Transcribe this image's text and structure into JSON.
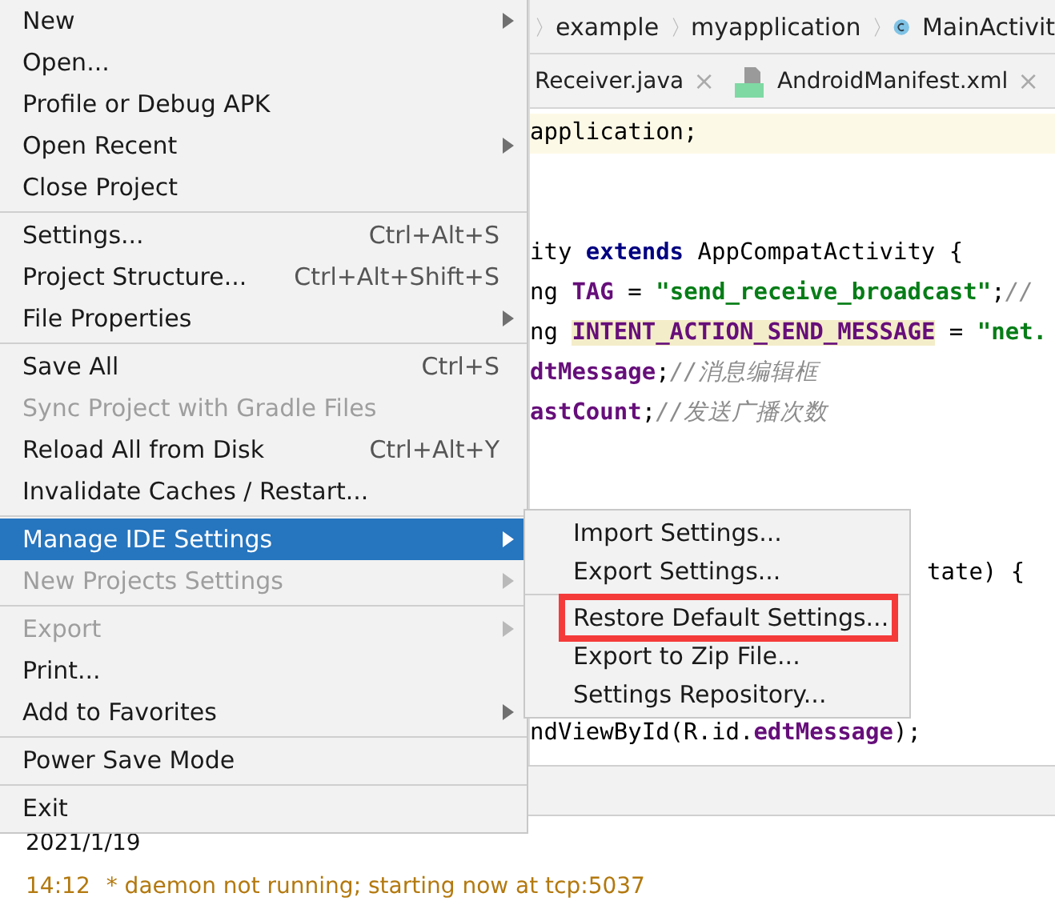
{
  "breadcrumb": {
    "items": [
      {
        "label": "example",
        "kind": "folder"
      },
      {
        "label": "myapplication",
        "kind": "folder"
      },
      {
        "label": "MainActivit",
        "kind": "class"
      }
    ]
  },
  "tabs": [
    {
      "label": "Receiver.java",
      "kind": "java",
      "close": "×",
      "selected": false
    },
    {
      "label": "AndroidManifest.xml",
      "kind": "manifest",
      "close": "×",
      "selected": false
    }
  ],
  "code": [
    {
      "highlighted": true,
      "tokens": [
        {
          "kind": "plain",
          "text": "application;"
        }
      ]
    },
    {
      "highlighted": false
    },
    {
      "highlighted": false
    },
    {
      "highlighted": false,
      "tokens": [
        {
          "kind": "plain",
          "text": "ity "
        },
        {
          "kind": "keyword",
          "text": "extends"
        },
        {
          "kind": "plain",
          "text": " AppCompatActivity {"
        }
      ]
    },
    {
      "highlighted": false,
      "tokens": [
        {
          "kind": "plain",
          "text": "ng "
        },
        {
          "kind": "field",
          "text": "TAG"
        },
        {
          "kind": "plain",
          "text": " = "
        },
        {
          "kind": "string",
          "text": "\"send_receive_broadcast\""
        },
        {
          "kind": "plain",
          "text": ";"
        },
        {
          "kind": "comment",
          "text": "//"
        }
      ]
    },
    {
      "highlighted": false,
      "tokens": [
        {
          "kind": "plain",
          "text": "ng "
        },
        {
          "kind": "marked",
          "text": "INTENT_ACTION_SEND_MESSAGE"
        },
        {
          "kind": "plain",
          "text": " = "
        },
        {
          "kind": "string",
          "text": "\"net."
        }
      ]
    },
    {
      "highlighted": false,
      "tokens": [
        {
          "kind": "field",
          "text": "dtMessage"
        },
        {
          "kind": "plain",
          "text": ";"
        },
        {
          "kind": "comment",
          "text": "//消息编辑框"
        }
      ]
    },
    {
      "highlighted": false,
      "tokens": [
        {
          "kind": "field",
          "text": "astCount"
        },
        {
          "kind": "plain",
          "text": ";"
        },
        {
          "kind": "comment",
          "text": "//发送广播次数"
        }
      ]
    },
    {
      "highlighted": false
    },
    {
      "highlighted": false
    },
    {
      "highlighted": false
    },
    {
      "highlighted": false,
      "covered": true,
      "tokens": [
        {
          "kind": "plain",
          "text": "tate) {"
        }
      ]
    },
    {
      "highlighted": false
    },
    {
      "highlighted": false
    },
    {
      "highlighted": false
    },
    {
      "highlighted": false,
      "tokens": [
        {
          "kind": "plain",
          "text": "ndViewById(R.id."
        },
        {
          "kind": "field",
          "text": "edtMessage"
        },
        {
          "kind": "plain",
          "text": ");"
        }
      ]
    }
  ],
  "log": [
    {
      "text": "2021/1/19",
      "kind": "date"
    },
    {
      "time": "14:12",
      "text": "* daemon not running; starting now at tcp:5037",
      "kind": "warning"
    }
  ],
  "menu": [
    {
      "kind": "item",
      "label": "New",
      "submenu": true,
      "disabled": false,
      "selected": false
    },
    {
      "kind": "item",
      "label": "Open...",
      "submenu": false,
      "disabled": false,
      "selected": false
    },
    {
      "kind": "item",
      "label": "Profile or Debug APK",
      "submenu": false,
      "disabled": false,
      "selected": false
    },
    {
      "kind": "item",
      "label": "Open Recent",
      "submenu": true,
      "disabled": false,
      "selected": false
    },
    {
      "kind": "item",
      "label": "Close Project",
      "submenu": false,
      "disabled": false,
      "selected": false
    },
    {
      "kind": "separator"
    },
    {
      "kind": "item",
      "label": "Settings...",
      "shortcut": "Ctrl+Alt+S",
      "submenu": false,
      "disabled": false,
      "selected": false
    },
    {
      "kind": "item",
      "label": "Project Structure...",
      "shortcut": "Ctrl+Alt+Shift+S",
      "submenu": false,
      "disabled": false,
      "selected": false
    },
    {
      "kind": "item",
      "label": "File Properties",
      "submenu": true,
      "disabled": false,
      "selected": false
    },
    {
      "kind": "separator"
    },
    {
      "kind": "item",
      "label": "Save All",
      "shortcut": "Ctrl+S",
      "submenu": false,
      "disabled": false,
      "selected": false
    },
    {
      "kind": "item",
      "label": "Sync Project with Gradle Files",
      "submenu": false,
      "disabled": true,
      "selected": false
    },
    {
      "kind": "item",
      "label": "Reload All from Disk",
      "shortcut": "Ctrl+Alt+Y",
      "submenu": false,
      "disabled": false,
      "selected": false
    },
    {
      "kind": "item",
      "label": "Invalidate Caches / Restart...",
      "submenu": false,
      "disabled": false,
      "selected": false
    },
    {
      "kind": "separator"
    },
    {
      "kind": "item",
      "label": "Manage IDE Settings",
      "submenu": true,
      "disabled": false,
      "selected": true
    },
    {
      "kind": "item",
      "label": "New Projects Settings",
      "submenu": true,
      "disabled": true,
      "selected": false
    },
    {
      "kind": "separator"
    },
    {
      "kind": "item",
      "label": "Export",
      "submenu": true,
      "disabled": true,
      "selected": false
    },
    {
      "kind": "item",
      "label": "Print...",
      "submenu": false,
      "disabled": false,
      "selected": false
    },
    {
      "kind": "item",
      "label": "Add to Favorites",
      "submenu": true,
      "disabled": false,
      "selected": false
    },
    {
      "kind": "separator"
    },
    {
      "kind": "item",
      "label": "Power Save Mode",
      "submenu": false,
      "disabled": false,
      "selected": false
    },
    {
      "kind": "separator"
    },
    {
      "kind": "item",
      "label": "Exit",
      "submenu": false,
      "disabled": false,
      "selected": false
    }
  ],
  "submenu": [
    {
      "kind": "item",
      "label": "Import Settings...",
      "outlined": false
    },
    {
      "kind": "item",
      "label": "Export Settings...",
      "outlined": false
    },
    {
      "kind": "separator"
    },
    {
      "kind": "item",
      "label": "Restore Default Settings...",
      "outlined": true
    },
    {
      "kind": "item",
      "label": "Export to Zip File...",
      "outlined": false
    },
    {
      "kind": "item",
      "label": "Settings Repository...",
      "outlined": false
    }
  ]
}
